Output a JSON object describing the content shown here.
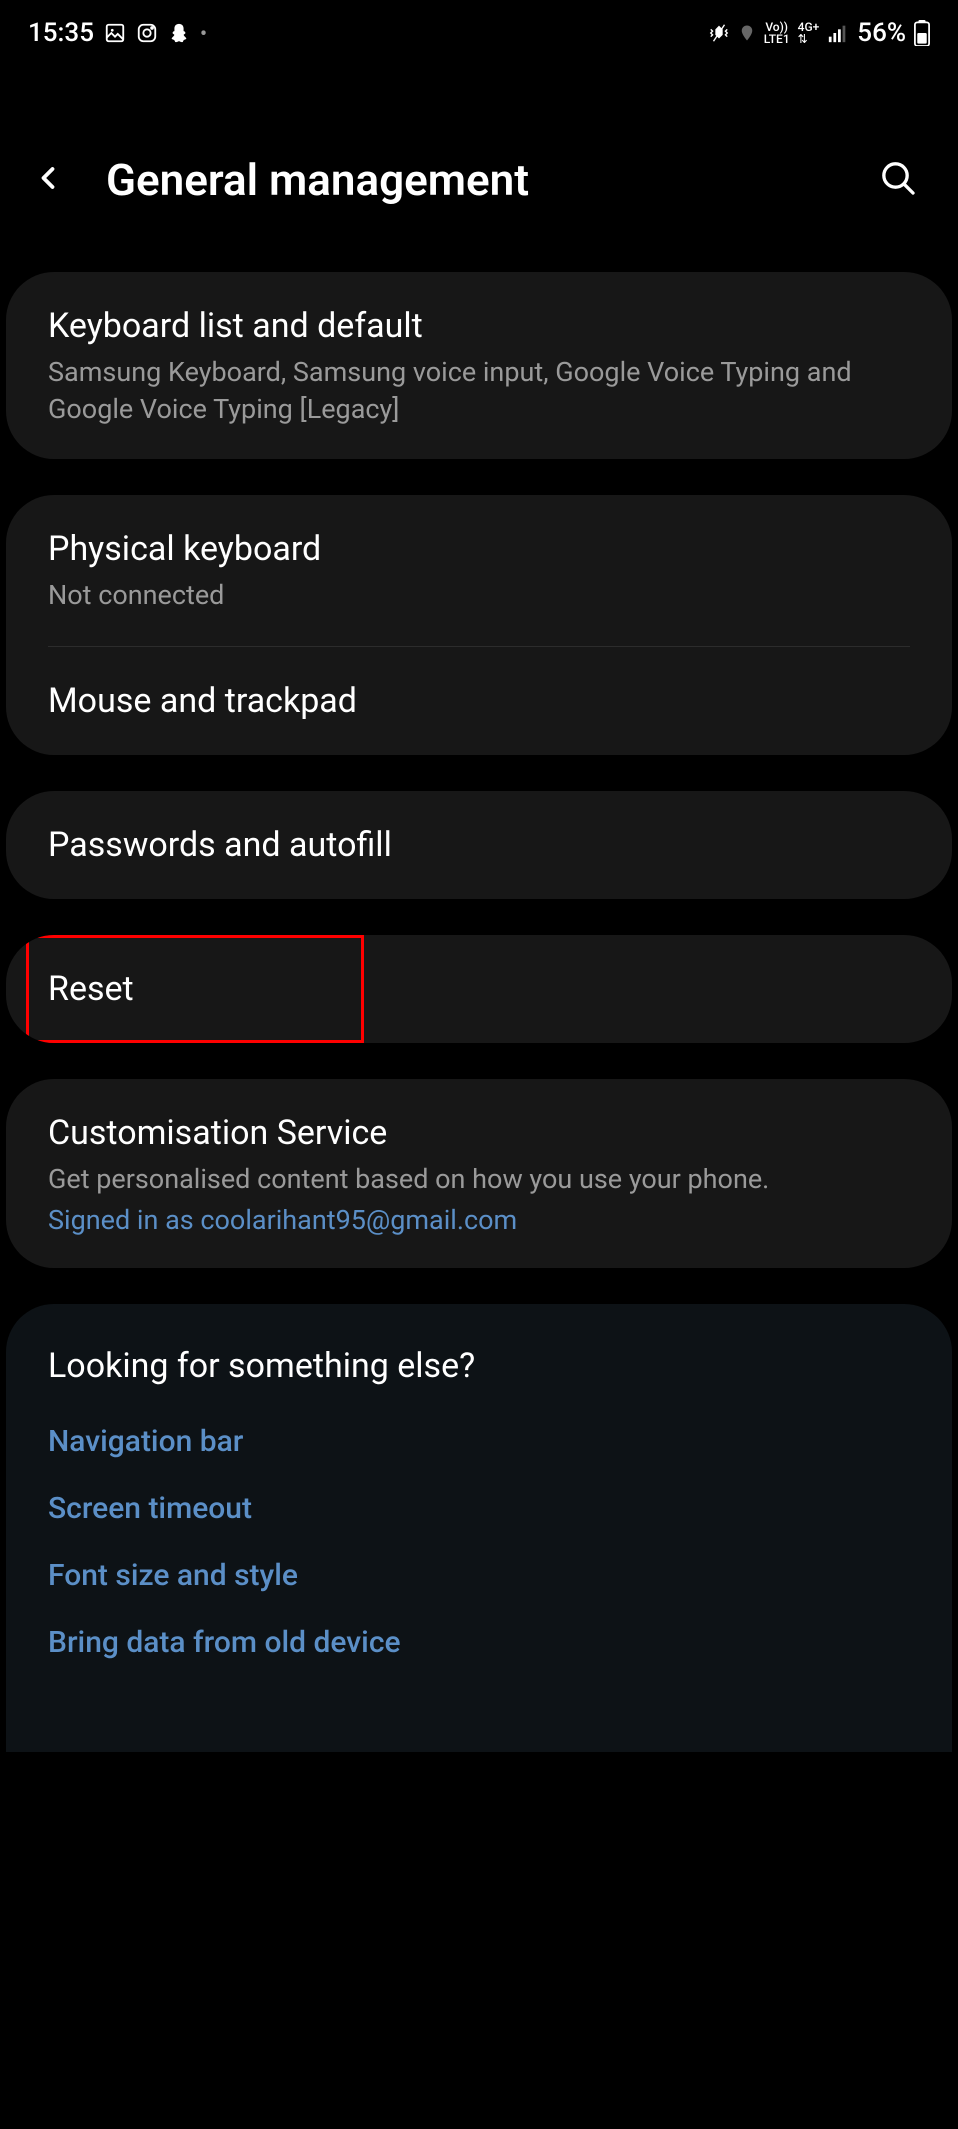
{
  "status": {
    "time": "15:35",
    "battery": "56%"
  },
  "header": {
    "title": "General management"
  },
  "sections": {
    "keyboard": {
      "title": "Keyboard list and default",
      "sub": "Samsung Keyboard, Samsung voice input, Google Voice Typing and Google Voice Typing [Legacy]"
    },
    "physical": {
      "title": "Physical keyboard",
      "sub": "Not connected"
    },
    "mouse": {
      "title": "Mouse and trackpad"
    },
    "passwords": {
      "title": "Passwords and autofill"
    },
    "reset": {
      "title": "Reset"
    },
    "customisation": {
      "title": "Customisation Service",
      "sub": "Get personalised content based on how you use your phone.",
      "signed": "Signed in as coolarihant95@gmail.com"
    },
    "looking": {
      "title": "Looking for something else?",
      "links": {
        "nav": "Navigation bar",
        "timeout": "Screen timeout",
        "font": "Font size and style",
        "bring": "Bring data from old device"
      }
    }
  }
}
